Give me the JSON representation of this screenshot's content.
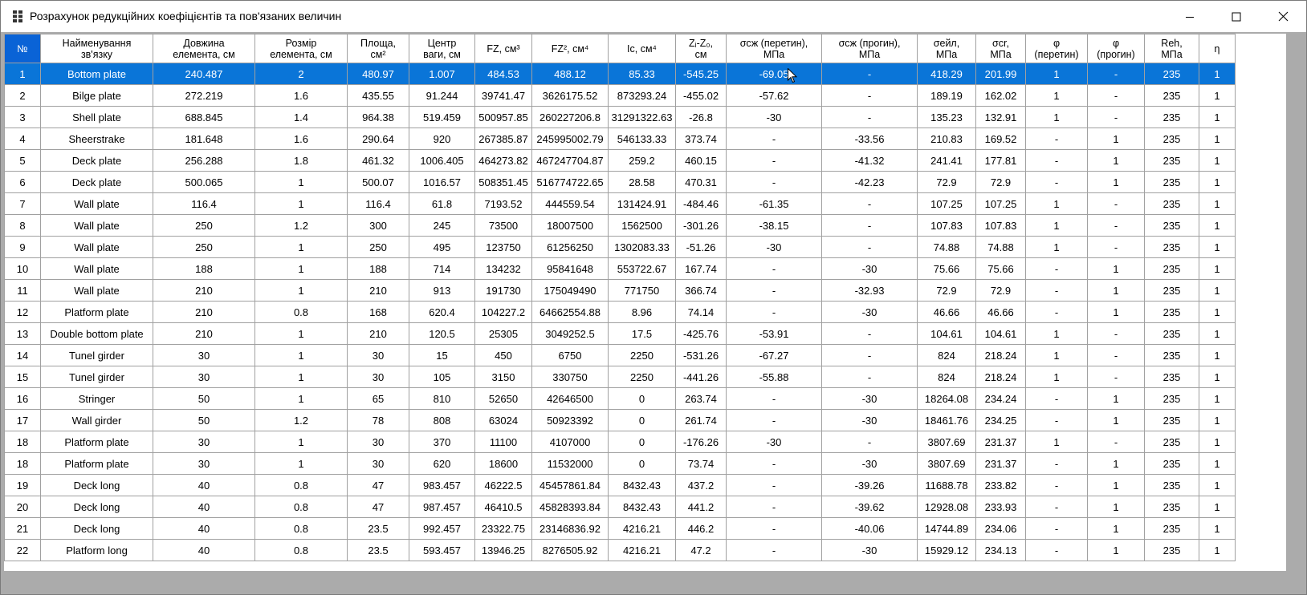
{
  "window": {
    "title": "Розрахунок редукційних коефіцієнтів та пов'язаних величин",
    "icon": "grid-app-icon",
    "controls": {
      "minimize": "minimize-icon",
      "maximize": "maximize-icon",
      "close": "close-icon"
    }
  },
  "table": {
    "headers": [
      [
        "№"
      ],
      [
        "Найменування",
        "зв'язку"
      ],
      [
        "Довжина",
        "елемента, см"
      ],
      [
        "Розмір",
        "елемента, см"
      ],
      [
        "Площа,",
        "см²"
      ],
      [
        "Центр",
        "ваги, см"
      ],
      [
        "FZ, см³"
      ],
      [
        "FZ², см⁴"
      ],
      [
        "Ic, см⁴"
      ],
      [
        "Zᵢ-Z₀,",
        "см"
      ],
      [
        "σсж (перетин),",
        "МПа"
      ],
      [
        "σсж (прогин),",
        "МПа"
      ],
      [
        "σейл,",
        "МПа"
      ],
      [
        "σcr,",
        "МПа"
      ],
      [
        "φ",
        "(перетин)"
      ],
      [
        "φ",
        "(прогин)"
      ],
      [
        "Reh,",
        "МПа"
      ],
      [
        "η"
      ]
    ],
    "selected_row": 0,
    "rows": [
      [
        "1",
        "Bottom plate",
        "240.487",
        "2",
        "480.97",
        "1.007",
        "484.53",
        "488.12",
        "85.33",
        "-545.25",
        "-69.05",
        "-",
        "418.29",
        "201.99",
        "1",
        "-",
        "235",
        "1"
      ],
      [
        "2",
        "Bilge plate",
        "272.219",
        "1.6",
        "435.55",
        "91.244",
        "39741.47",
        "3626175.52",
        "873293.24",
        "-455.02",
        "-57.62",
        "-",
        "189.19",
        "162.02",
        "1",
        "-",
        "235",
        "1"
      ],
      [
        "3",
        "Shell plate",
        "688.845",
        "1.4",
        "964.38",
        "519.459",
        "500957.85",
        "260227206.8",
        "31291322.63",
        "-26.8",
        "-30",
        "-",
        "135.23",
        "132.91",
        "1",
        "-",
        "235",
        "1"
      ],
      [
        "4",
        "Sheerstrake",
        "181.648",
        "1.6",
        "290.64",
        "920",
        "267385.87",
        "245995002.79",
        "546133.33",
        "373.74",
        "-",
        "-33.56",
        "210.83",
        "169.52",
        "-",
        "1",
        "235",
        "1"
      ],
      [
        "5",
        "Deck plate",
        "256.288",
        "1.8",
        "461.32",
        "1006.405",
        "464273.82",
        "467247704.87",
        "259.2",
        "460.15",
        "-",
        "-41.32",
        "241.41",
        "177.81",
        "-",
        "1",
        "235",
        "1"
      ],
      [
        "6",
        "Deck plate",
        "500.065",
        "1",
        "500.07",
        "1016.57",
        "508351.45",
        "516774722.65",
        "28.58",
        "470.31",
        "-",
        "-42.23",
        "72.9",
        "72.9",
        "-",
        "1",
        "235",
        "1"
      ],
      [
        "7",
        "Wall plate",
        "116.4",
        "1",
        "116.4",
        "61.8",
        "7193.52",
        "444559.54",
        "131424.91",
        "-484.46",
        "-61.35",
        "-",
        "107.25",
        "107.25",
        "1",
        "-",
        "235",
        "1"
      ],
      [
        "8",
        "Wall plate",
        "250",
        "1.2",
        "300",
        "245",
        "73500",
        "18007500",
        "1562500",
        "-301.26",
        "-38.15",
        "-",
        "107.83",
        "107.83",
        "1",
        "-",
        "235",
        "1"
      ],
      [
        "9",
        "Wall plate",
        "250",
        "1",
        "250",
        "495",
        "123750",
        "61256250",
        "1302083.33",
        "-51.26",
        "-30",
        "-",
        "74.88",
        "74.88",
        "1",
        "-",
        "235",
        "1"
      ],
      [
        "10",
        "Wall plate",
        "188",
        "1",
        "188",
        "714",
        "134232",
        "95841648",
        "553722.67",
        "167.74",
        "-",
        "-30",
        "75.66",
        "75.66",
        "-",
        "1",
        "235",
        "1"
      ],
      [
        "11",
        "Wall plate",
        "210",
        "1",
        "210",
        "913",
        "191730",
        "175049490",
        "771750",
        "366.74",
        "-",
        "-32.93",
        "72.9",
        "72.9",
        "-",
        "1",
        "235",
        "1"
      ],
      [
        "12",
        "Platform plate",
        "210",
        "0.8",
        "168",
        "620.4",
        "104227.2",
        "64662554.88",
        "8.96",
        "74.14",
        "-",
        "-30",
        "46.66",
        "46.66",
        "-",
        "1",
        "235",
        "1"
      ],
      [
        "13",
        "Double bottom plate",
        "210",
        "1",
        "210",
        "120.5",
        "25305",
        "3049252.5",
        "17.5",
        "-425.76",
        "-53.91",
        "-",
        "104.61",
        "104.61",
        "1",
        "-",
        "235",
        "1"
      ],
      [
        "14",
        "Tunel girder",
        "30",
        "1",
        "30",
        "15",
        "450",
        "6750",
        "2250",
        "-531.26",
        "-67.27",
        "-",
        "824",
        "218.24",
        "1",
        "-",
        "235",
        "1"
      ],
      [
        "15",
        "Tunel girder",
        "30",
        "1",
        "30",
        "105",
        "3150",
        "330750",
        "2250",
        "-441.26",
        "-55.88",
        "-",
        "824",
        "218.24",
        "1",
        "-",
        "235",
        "1"
      ],
      [
        "16",
        "Stringer",
        "50",
        "1",
        "65",
        "810",
        "52650",
        "42646500",
        "0",
        "263.74",
        "-",
        "-30",
        "18264.08",
        "234.24",
        "-",
        "1",
        "235",
        "1"
      ],
      [
        "17",
        "Wall girder",
        "50",
        "1.2",
        "78",
        "808",
        "63024",
        "50923392",
        "0",
        "261.74",
        "-",
        "-30",
        "18461.76",
        "234.25",
        "-",
        "1",
        "235",
        "1"
      ],
      [
        "18",
        "Platform plate",
        "30",
        "1",
        "30",
        "370",
        "11100",
        "4107000",
        "0",
        "-176.26",
        "-30",
        "-",
        "3807.69",
        "231.37",
        "1",
        "-",
        "235",
        "1"
      ],
      [
        "18",
        "Platform plate",
        "30",
        "1",
        "30",
        "620",
        "18600",
        "11532000",
        "0",
        "73.74",
        "-",
        "-30",
        "3807.69",
        "231.37",
        "-",
        "1",
        "235",
        "1"
      ],
      [
        "19",
        "Deck long",
        "40",
        "0.8",
        "47",
        "983.457",
        "46222.5",
        "45457861.84",
        "8432.43",
        "437.2",
        "-",
        "-39.26",
        "11688.78",
        "233.82",
        "-",
        "1",
        "235",
        "1"
      ],
      [
        "20",
        "Deck long",
        "40",
        "0.8",
        "47",
        "987.457",
        "46410.5",
        "45828393.84",
        "8432.43",
        "441.2",
        "-",
        "-39.62",
        "12928.08",
        "233.93",
        "-",
        "1",
        "235",
        "1"
      ],
      [
        "21",
        "Deck long",
        "40",
        "0.8",
        "23.5",
        "992.457",
        "23322.75",
        "23146836.92",
        "4216.21",
        "446.2",
        "-",
        "-40.06",
        "14744.89",
        "234.06",
        "-",
        "1",
        "235",
        "1"
      ],
      [
        "22",
        "Platform long",
        "40",
        "0.8",
        "23.5",
        "593.457",
        "13946.25",
        "8276505.92",
        "4216.21",
        "47.2",
        "-",
        "-30",
        "15929.12",
        "234.13",
        "-",
        "1",
        "235",
        "1"
      ]
    ]
  },
  "colors": {
    "selection": "#0a75d8",
    "header_selected": "#0a63d6",
    "gridline": "#a0a0a0",
    "background": "#ababab"
  },
  "cursor": "mouse-pointer-icon"
}
